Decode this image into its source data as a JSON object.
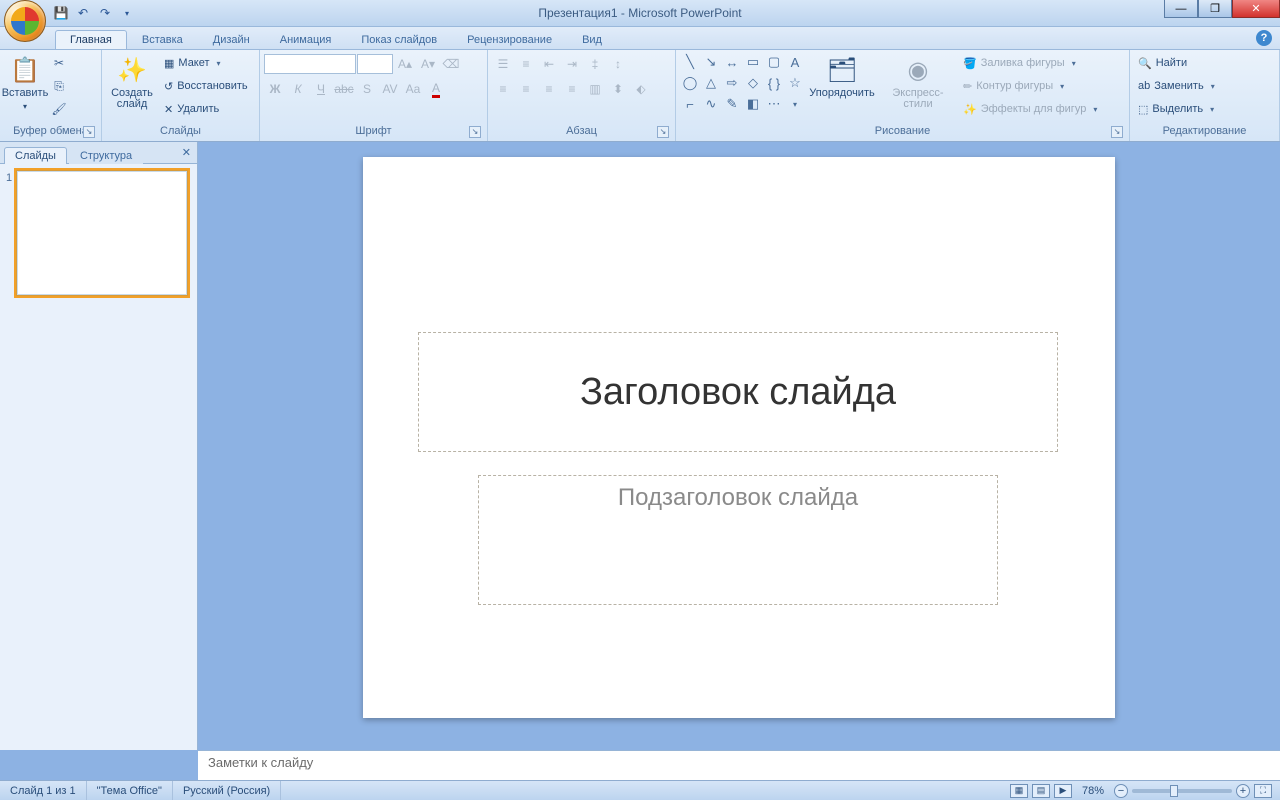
{
  "title": {
    "doc": "Презентация1",
    "app": "Microsoft PowerPoint"
  },
  "qat": {
    "save_tip": "save-icon",
    "undo_tip": "undo-icon",
    "redo_tip": "redo-icon"
  },
  "tabs": {
    "home": "Главная",
    "insert": "Вставка",
    "design": "Дизайн",
    "anim": "Анимация",
    "show": "Показ слайдов",
    "review": "Рецензирование",
    "view": "Вид"
  },
  "ribbon": {
    "clipboard": {
      "label": "Буфер обмена",
      "paste": "Вставить"
    },
    "slides": {
      "label": "Слайды",
      "new": "Создать\nслайд",
      "layout": "Макет",
      "reset": "Восстановить",
      "delete": "Удалить"
    },
    "font": {
      "label": "Шрифт"
    },
    "para": {
      "label": "Абзац"
    },
    "draw": {
      "label": "Рисование",
      "arrange": "Упорядочить",
      "quick": "Экспресс-стили",
      "fill": "Заливка фигуры",
      "outline": "Контур фигуры",
      "effects": "Эффекты для фигур"
    },
    "edit": {
      "label": "Редактирование",
      "find": "Найти",
      "replace": "Заменить",
      "select": "Выделить"
    }
  },
  "pane": {
    "slides_tab": "Слайды",
    "outline_tab": "Структура",
    "thumb_num": "1"
  },
  "slide": {
    "title": "Заголовок слайда",
    "subtitle": "Подзаголовок слайда"
  },
  "notes": {
    "placeholder": "Заметки к слайду"
  },
  "status": {
    "slide": "Слайд 1 из 1",
    "theme": "\"Тема Office\"",
    "lang": "Русский (Россия)",
    "zoom": "78%"
  }
}
